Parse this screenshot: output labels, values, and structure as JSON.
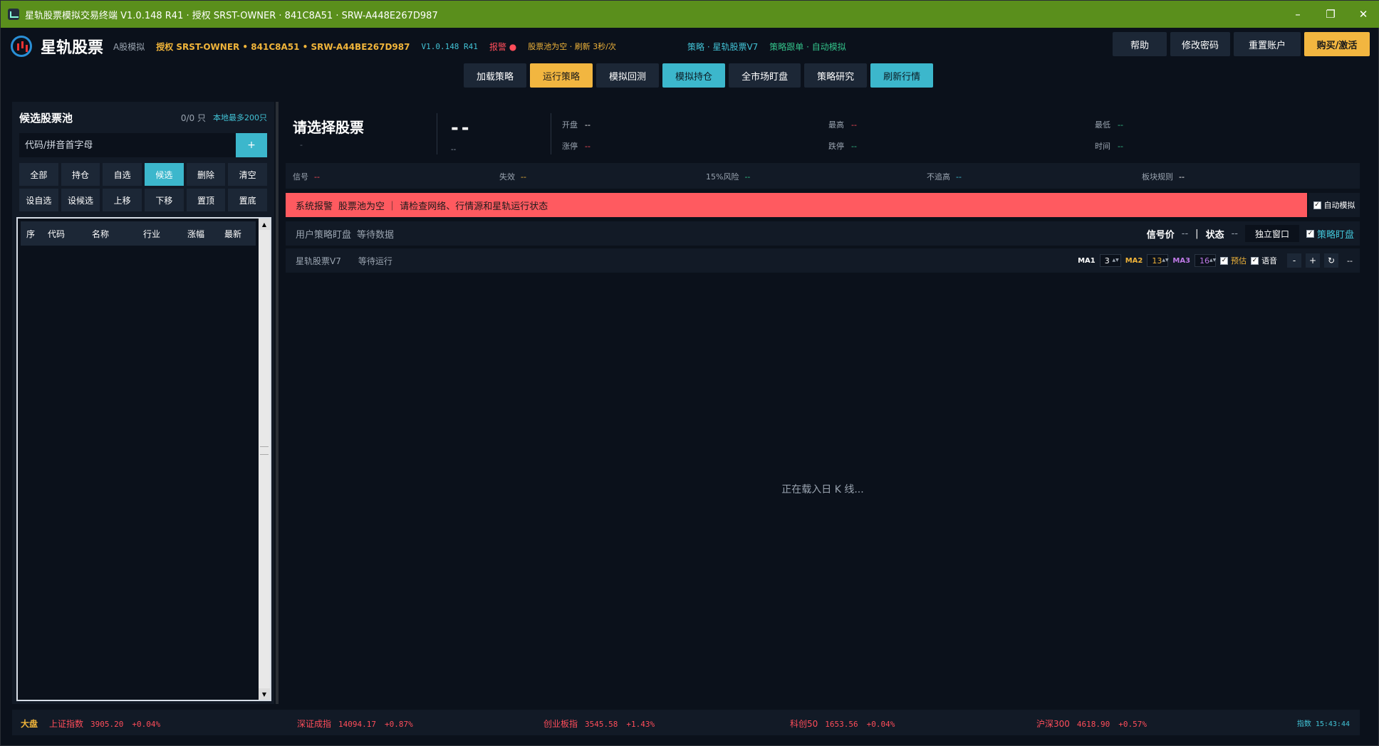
{
  "window": {
    "title": "星轨股票模拟交易终端 V1.0.148 R41 · 授权 SRST-OWNER · 841C8A51 · SRW-A448E267D987"
  },
  "header": {
    "logo": "星轨股票",
    "mode": "A股模拟",
    "license": "授权 SRST-OWNER • 841C8A51 • SRW-A44BE267D987",
    "version": "V1.0.148 R41",
    "alarm": "报警 ●",
    "pool_status": "股票池为空 · 刷新 3秒/次",
    "strategy": "策略 · 星轨股票V7",
    "follow": "策略跟单 · 自动模拟",
    "buttons": [
      "帮助",
      "修改密码",
      "重置账户",
      "购买/激活"
    ]
  },
  "toolbar": [
    "加载策略",
    "运行策略",
    "模拟回测",
    "模拟持仓",
    "全市场盯盘",
    "策略研究",
    "刷新行情"
  ],
  "left": {
    "title": "候选股票池",
    "count": "0/0 只",
    "limit": "本地最多200只",
    "search_placeholder": "代码/拼音首字母",
    "add": "+",
    "buttons_row1": [
      "全部",
      "持仓",
      "自选",
      "候选",
      "删除",
      "清空"
    ],
    "buttons_row2": [
      "设自选",
      "设候选",
      "上移",
      "下移",
      "置顶",
      "置底"
    ],
    "columns": [
      "序",
      "代码",
      "名称",
      "行业",
      "涨幅",
      "最新"
    ]
  },
  "quote": {
    "title": "请选择股票",
    "sub": "-",
    "price": "--",
    "change": "--",
    "fields": [
      {
        "label": "开盘",
        "value": "--"
      },
      {
        "label": "最高",
        "value": "--"
      },
      {
        "label": "最低",
        "value": "--"
      },
      {
        "label": "涨停",
        "value": "--"
      },
      {
        "label": "跌停",
        "value": "--"
      },
      {
        "label": "时间",
        "value": "--"
      }
    ]
  },
  "signals": [
    {
      "label": "信号",
      "value": "--"
    },
    {
      "label": "失效",
      "value": "--"
    },
    {
      "label": "15%风险",
      "value": "--"
    },
    {
      "label": "不追高",
      "value": "--"
    },
    {
      "label": "板块规则",
      "value": "--"
    }
  ],
  "alert": {
    "kind": "系统报警",
    "msg": "股票池为空 ｜ 请检查网络、行情源和星轨运行状态",
    "auto": "自动模拟"
  },
  "strategy_bar": {
    "label": "用户策略盯盘",
    "status": "等待数据",
    "signal_price_label": "信号价",
    "signal_price": "--",
    "sep": "|",
    "state_label": "状态",
    "state": "--",
    "window_btn": "独立窗口",
    "watch": "策略盯盘"
  },
  "strategy_row": {
    "name": "星轨股票V7",
    "status": "等待运行",
    "ma1_label": "MA1",
    "ma1": "3",
    "ma2_label": "MA2",
    "ma2": "13",
    "ma3_label": "MA3",
    "ma3": "16",
    "estimate": "预估",
    "voice": "语音",
    "minus": "-",
    "plus": "+",
    "refresh": "↻",
    "dash": "--"
  },
  "chart": {
    "loading": "正在载入日 K 线..."
  },
  "footer": {
    "label": "大盘",
    "indices": [
      {
        "name": "上证指数",
        "value": "3905.20",
        "pct": "+0.04%"
      },
      {
        "name": "深证成指",
        "value": "14094.17",
        "pct": "+0.87%"
      },
      {
        "name": "创业板指",
        "value": "3545.58",
        "pct": "+1.43%"
      },
      {
        "name": "科创50",
        "value": "1653.56",
        "pct": "+0.04%"
      },
      {
        "name": "沪深300",
        "value": "4618.90",
        "pct": "+0.57%"
      }
    ],
    "time_label": "指数",
    "time": "15:43:44"
  }
}
